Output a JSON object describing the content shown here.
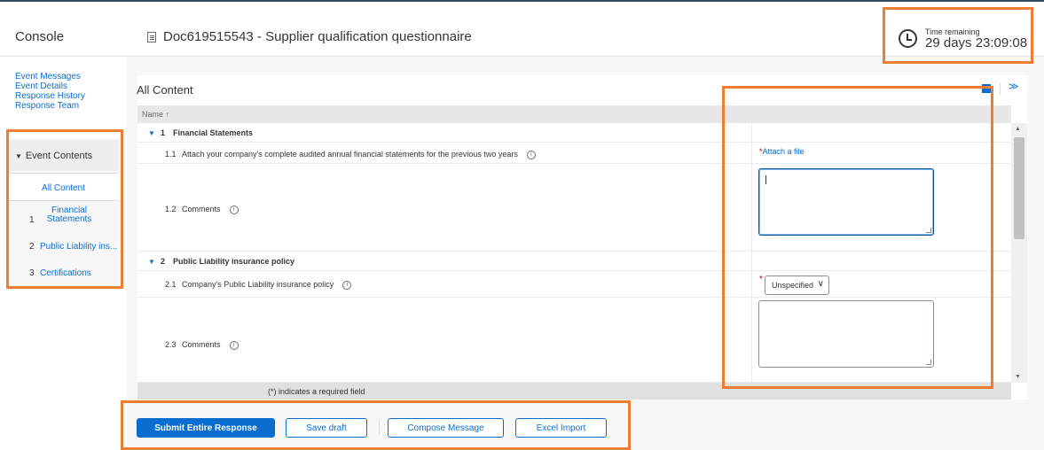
{
  "header": {
    "console_label": "Console",
    "doc_title": "Doc619515543 - Supplier qualification questionnaire",
    "time_remaining_label": "Time remaining",
    "time_remaining_value": "29 days 23:09:08"
  },
  "sidebar": {
    "links": [
      "Event Messages",
      "Event Details",
      "Response History",
      "Response Team"
    ],
    "event_contents_label": "Event Contents",
    "items": [
      {
        "num": "",
        "label": "All Content"
      },
      {
        "num": "1",
        "label": "Financial Statements"
      },
      {
        "num": "2",
        "label": "Public Liability ins..."
      },
      {
        "num": "3",
        "label": "Certifications"
      }
    ]
  },
  "main": {
    "title": "All Content",
    "column_name": "Name ↑",
    "sections": [
      {
        "num": "1",
        "title": "Financial Statements"
      },
      {
        "num": "2",
        "title": "Public Liability insurance policy"
      }
    ],
    "rows": [
      {
        "num": "1.1",
        "label": "Attach your company's complete audited annual financial statements for the previous two years"
      },
      {
        "num": "1.2",
        "label": "Comments"
      },
      {
        "num": "2.1",
        "label": "Company's Public Liability insurance policy"
      },
      {
        "num": "2.3",
        "label": "Comments"
      }
    ],
    "attach_label": "Attach a file",
    "select_value": "Unspecified",
    "required_note": "(*) indicates a required field"
  },
  "footer": {
    "submit_label": "Submit Entire Response",
    "save_label": "Save draft",
    "compose_label": "Compose Message",
    "excel_label": "Excel Import"
  },
  "colors": {
    "accent": "#0a6ed1",
    "highlight": "#ed7d31",
    "required": "#bb0000"
  }
}
